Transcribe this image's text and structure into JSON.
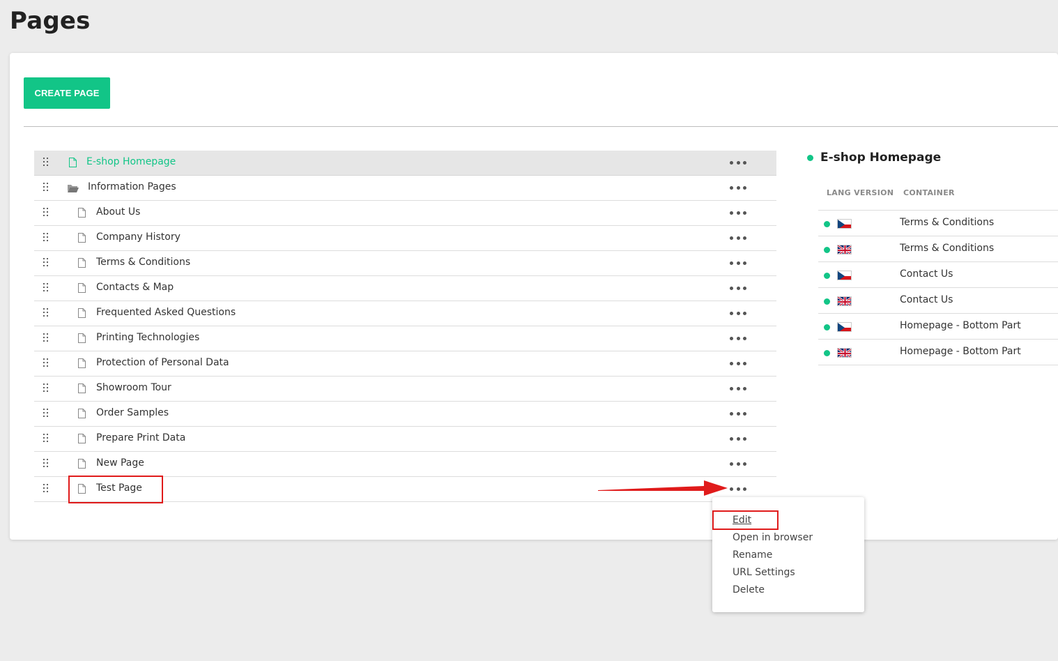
{
  "page": {
    "title": "Pages"
  },
  "toolbar": {
    "create_label": "CREATE PAGE"
  },
  "tree": {
    "items": [
      {
        "label": "E-shop Homepage",
        "type": "page",
        "level": 0,
        "selected": true
      },
      {
        "label": "Information Pages",
        "type": "folder",
        "level": 0
      },
      {
        "label": "About Us",
        "type": "page",
        "level": 1
      },
      {
        "label": "Company History",
        "type": "page",
        "level": 1
      },
      {
        "label": "Terms & Conditions",
        "type": "page",
        "level": 1
      },
      {
        "label": "Contacts & Map",
        "type": "page",
        "level": 1
      },
      {
        "label": "Frequented Asked Questions",
        "type": "page",
        "level": 1
      },
      {
        "label": "Printing Technologies",
        "type": "page",
        "level": 1
      },
      {
        "label": "Protection of Personal Data",
        "type": "page",
        "level": 1
      },
      {
        "label": "Showroom Tour",
        "type": "page",
        "level": 1
      },
      {
        "label": "Order Samples",
        "type": "page",
        "level": 1
      },
      {
        "label": "Prepare Print Data",
        "type": "page",
        "level": 1
      },
      {
        "label": "New Page",
        "type": "page",
        "level": 1
      },
      {
        "label": "Test Page",
        "type": "page",
        "level": 1,
        "highlighted": true
      }
    ]
  },
  "detail": {
    "title": "E-shop Homepage",
    "columns": {
      "lang": "LANG VERSION",
      "container": "CONTAINER"
    },
    "rows": [
      {
        "flag": "cz-flag-icon",
        "container": "Terms & Conditions"
      },
      {
        "flag": "gb-flag-icon",
        "container": "Terms & Conditions"
      },
      {
        "flag": "cz-flag-icon",
        "container": "Contact Us"
      },
      {
        "flag": "gb-flag-icon",
        "container": "Contact Us"
      },
      {
        "flag": "cz-flag-icon",
        "container": "Homepage - Bottom Part"
      },
      {
        "flag": "gb-flag-icon",
        "container": "Homepage - Bottom Part"
      }
    ]
  },
  "context_menu": {
    "items": [
      "Edit",
      "Open in browser",
      "Rename",
      "URL Settings",
      "Delete"
    ]
  },
  "colors": {
    "accent": "#12c587",
    "annotation": "#e01b1b",
    "background": "#ececec"
  }
}
